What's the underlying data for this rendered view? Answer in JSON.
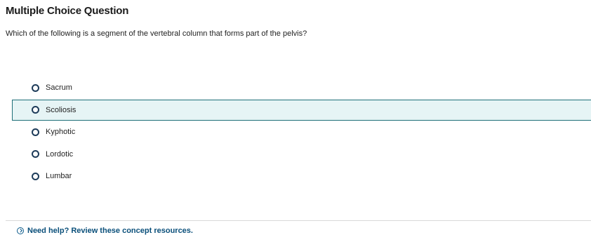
{
  "question": {
    "heading": "Multiple Choice Question",
    "prompt": "Which of the following is a segment of the vertebral column that forms part of the pelvis?",
    "options": [
      {
        "label": "Sacrum"
      },
      {
        "label": "Scoliosis"
      },
      {
        "label": "Kyphotic"
      },
      {
        "label": "Lordotic"
      },
      {
        "label": "Lumbar"
      }
    ]
  },
  "help": {
    "label": "Need help? Review these concept resources."
  },
  "colors": {
    "highlight_bg": "#e6f4f5",
    "highlight_border": "#1f6f78",
    "link": "#0a4f7a"
  },
  "icons": {
    "radio": "radio-button-icon",
    "help": "chevron-circle-icon"
  }
}
